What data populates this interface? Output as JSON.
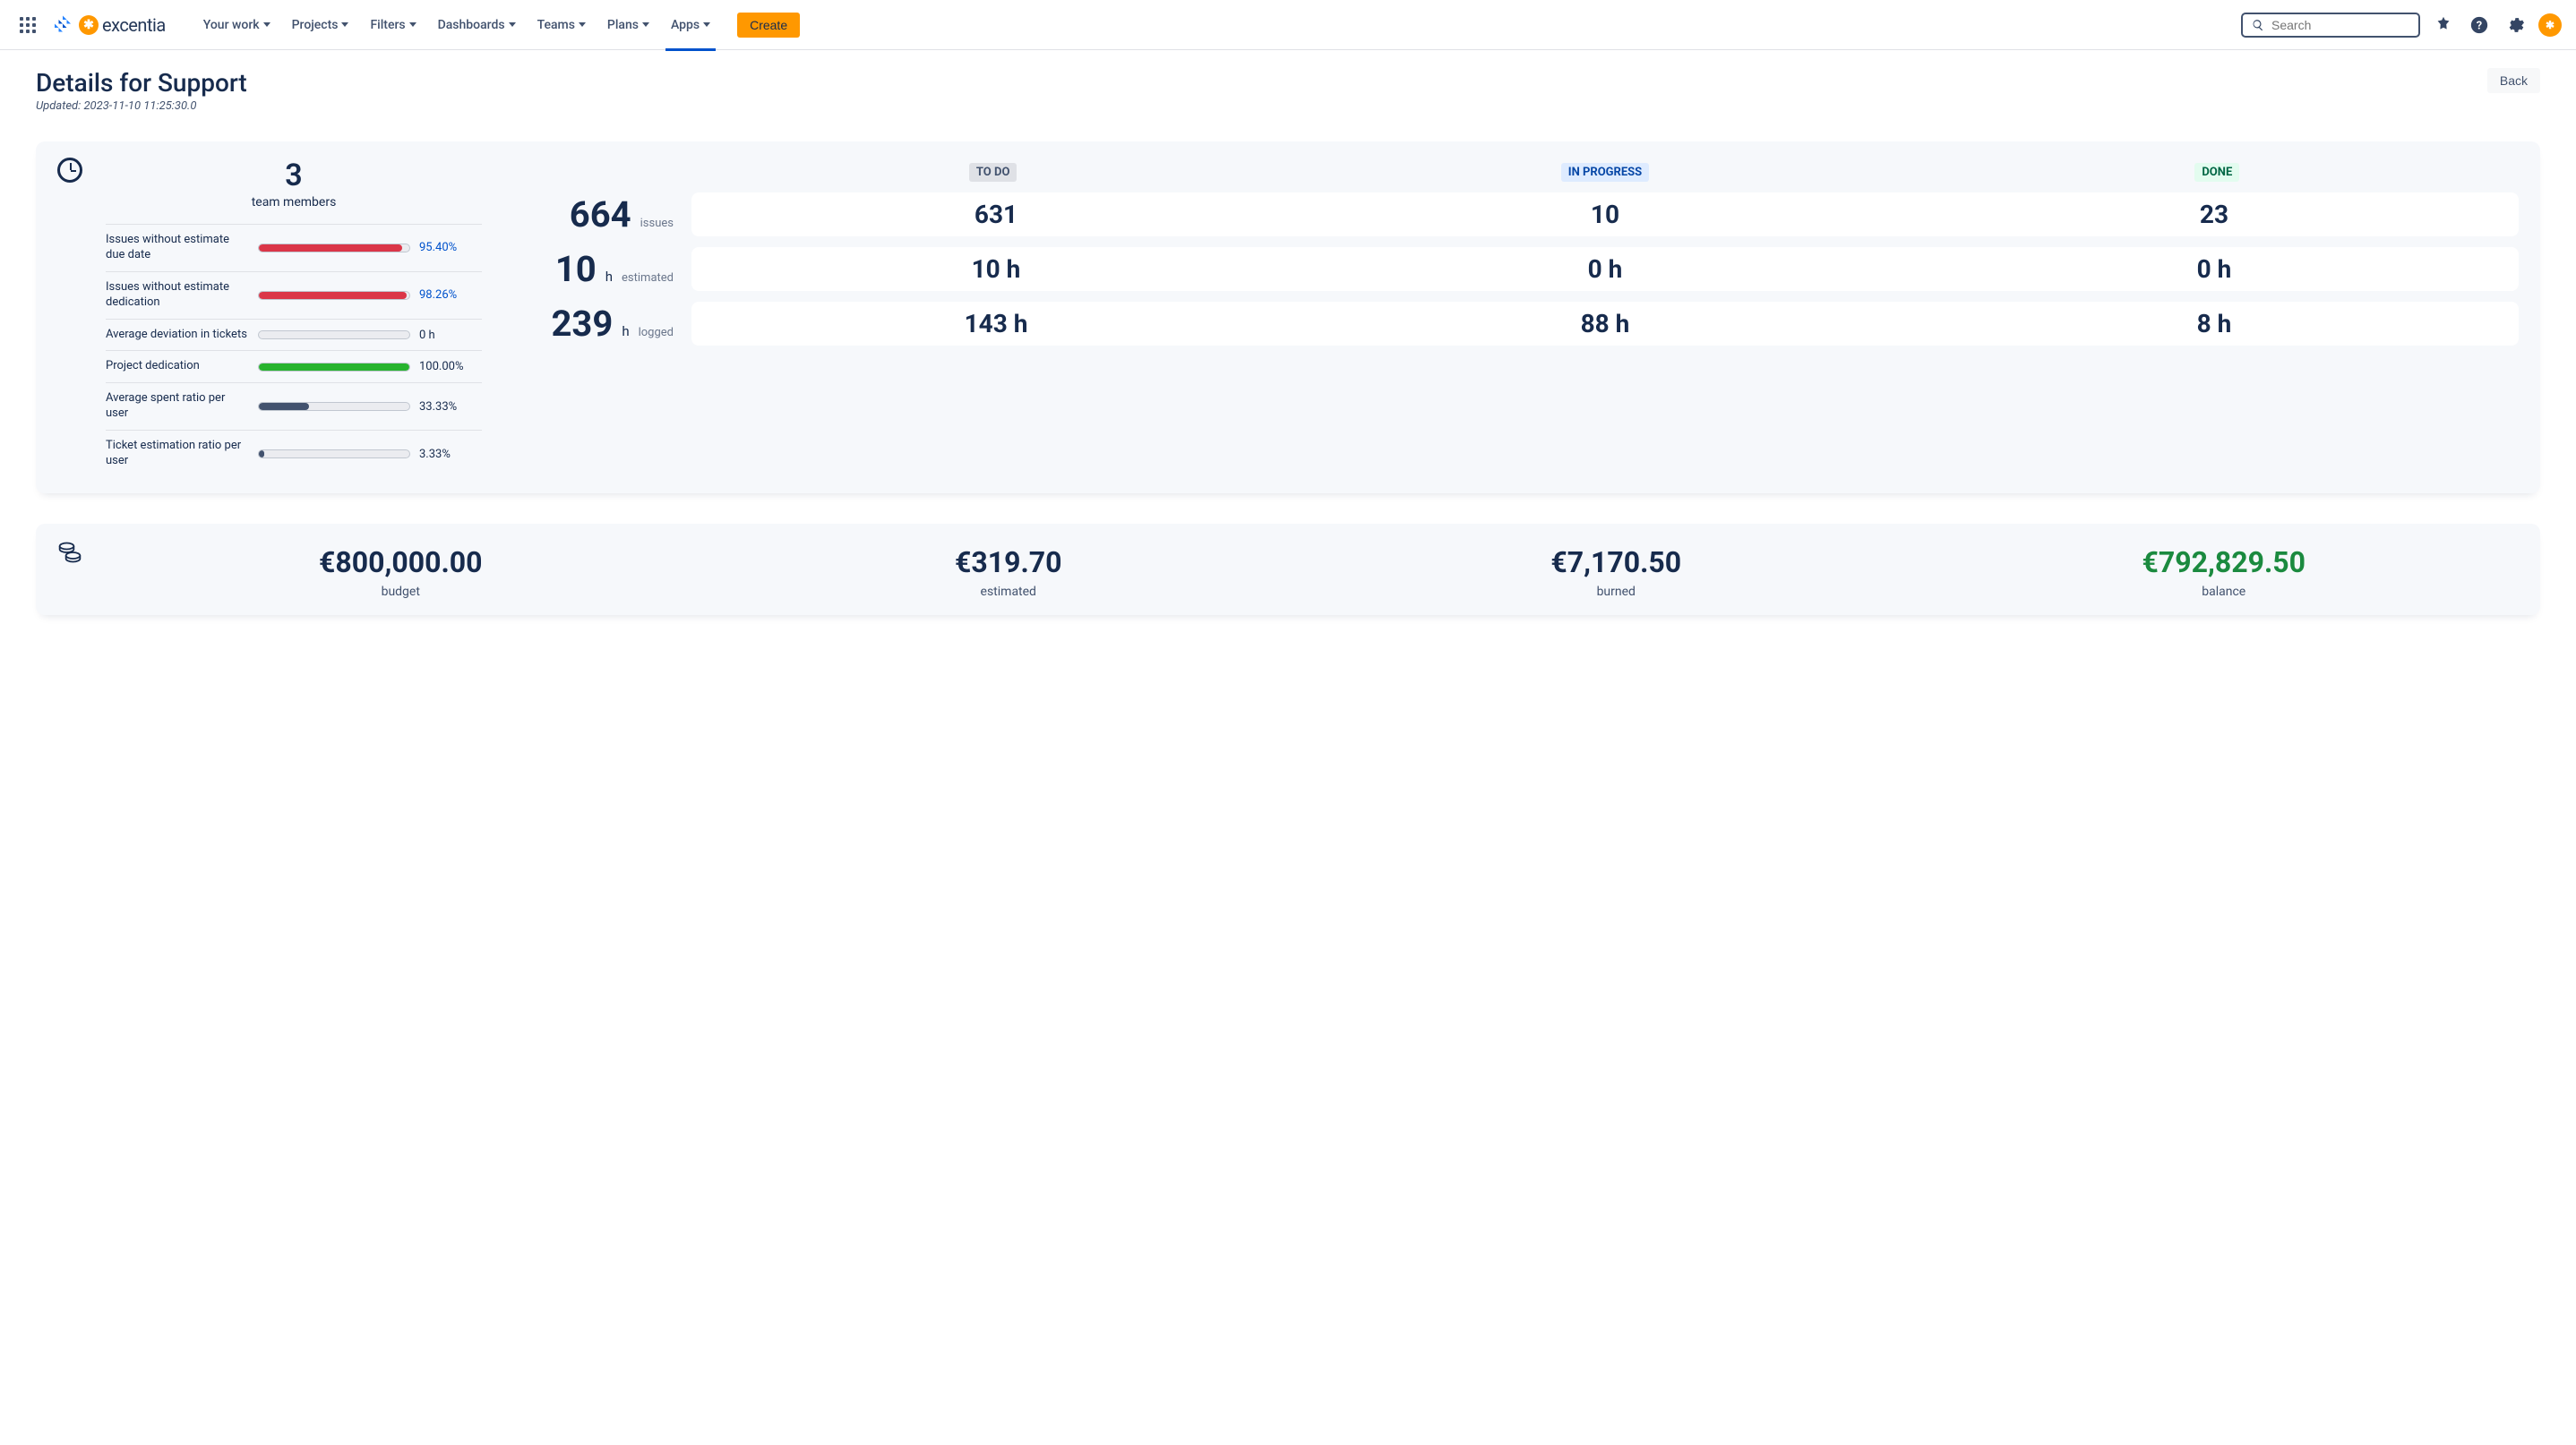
{
  "nav": {
    "items": [
      "Your work",
      "Projects",
      "Filters",
      "Dashboards",
      "Teams",
      "Plans",
      "Apps"
    ],
    "active_index": 6,
    "create": "Create",
    "search_placeholder": "Search",
    "logo_text": "excentia"
  },
  "page": {
    "title": "Details for Support",
    "updated": "Updated: 2023-11-10 11:25:30.0",
    "back": "Back"
  },
  "team": {
    "count": "3",
    "label": "team members"
  },
  "metrics": [
    {
      "label": "Issues without estimate due date",
      "value": "95.40%",
      "pct": 95.4,
      "color": "#DB3648",
      "link": true
    },
    {
      "label": "Issues without estimate dedication",
      "value": "98.26%",
      "pct": 98.26,
      "color": "#DB3648",
      "link": true
    },
    {
      "label": "Average deviation in tickets",
      "value": "0 h",
      "pct": 0,
      "color": "#EBECF0",
      "link": false
    },
    {
      "label": "Project dedication",
      "value": "100.00%",
      "pct": 100,
      "color": "#27B32E",
      "link": false
    },
    {
      "label": "Average spent ratio per user",
      "value": "33.33%",
      "pct": 33.33,
      "color": "#42526E",
      "link": false
    },
    {
      "label": "Ticket estimation ratio per user",
      "value": "3.33%",
      "pct": 3.33,
      "color": "#42526E",
      "link": false
    }
  ],
  "status_headers": {
    "todo": "TO DO",
    "progress": "IN PROGRESS",
    "done": "DONE"
  },
  "summary": {
    "issues": {
      "total": "664",
      "unit": "",
      "label": "issues",
      "todo": "631",
      "progress": "10",
      "done": "23"
    },
    "estimated": {
      "total": "10",
      "unit": "h",
      "label": "estimated",
      "todo": "10 h",
      "progress": "0 h",
      "done": "0 h"
    },
    "logged": {
      "total": "239",
      "unit": "h",
      "label": "logged",
      "todo": "143 h",
      "progress": "88 h",
      "done": "8 h"
    }
  },
  "budget": {
    "budget": {
      "value": "€800,000.00",
      "label": "budget"
    },
    "estimated": {
      "value": "€319.70",
      "label": "estimated"
    },
    "burned": {
      "value": "€7,170.50",
      "label": "burned"
    },
    "balance": {
      "value": "€792,829.50",
      "label": "balance"
    }
  }
}
